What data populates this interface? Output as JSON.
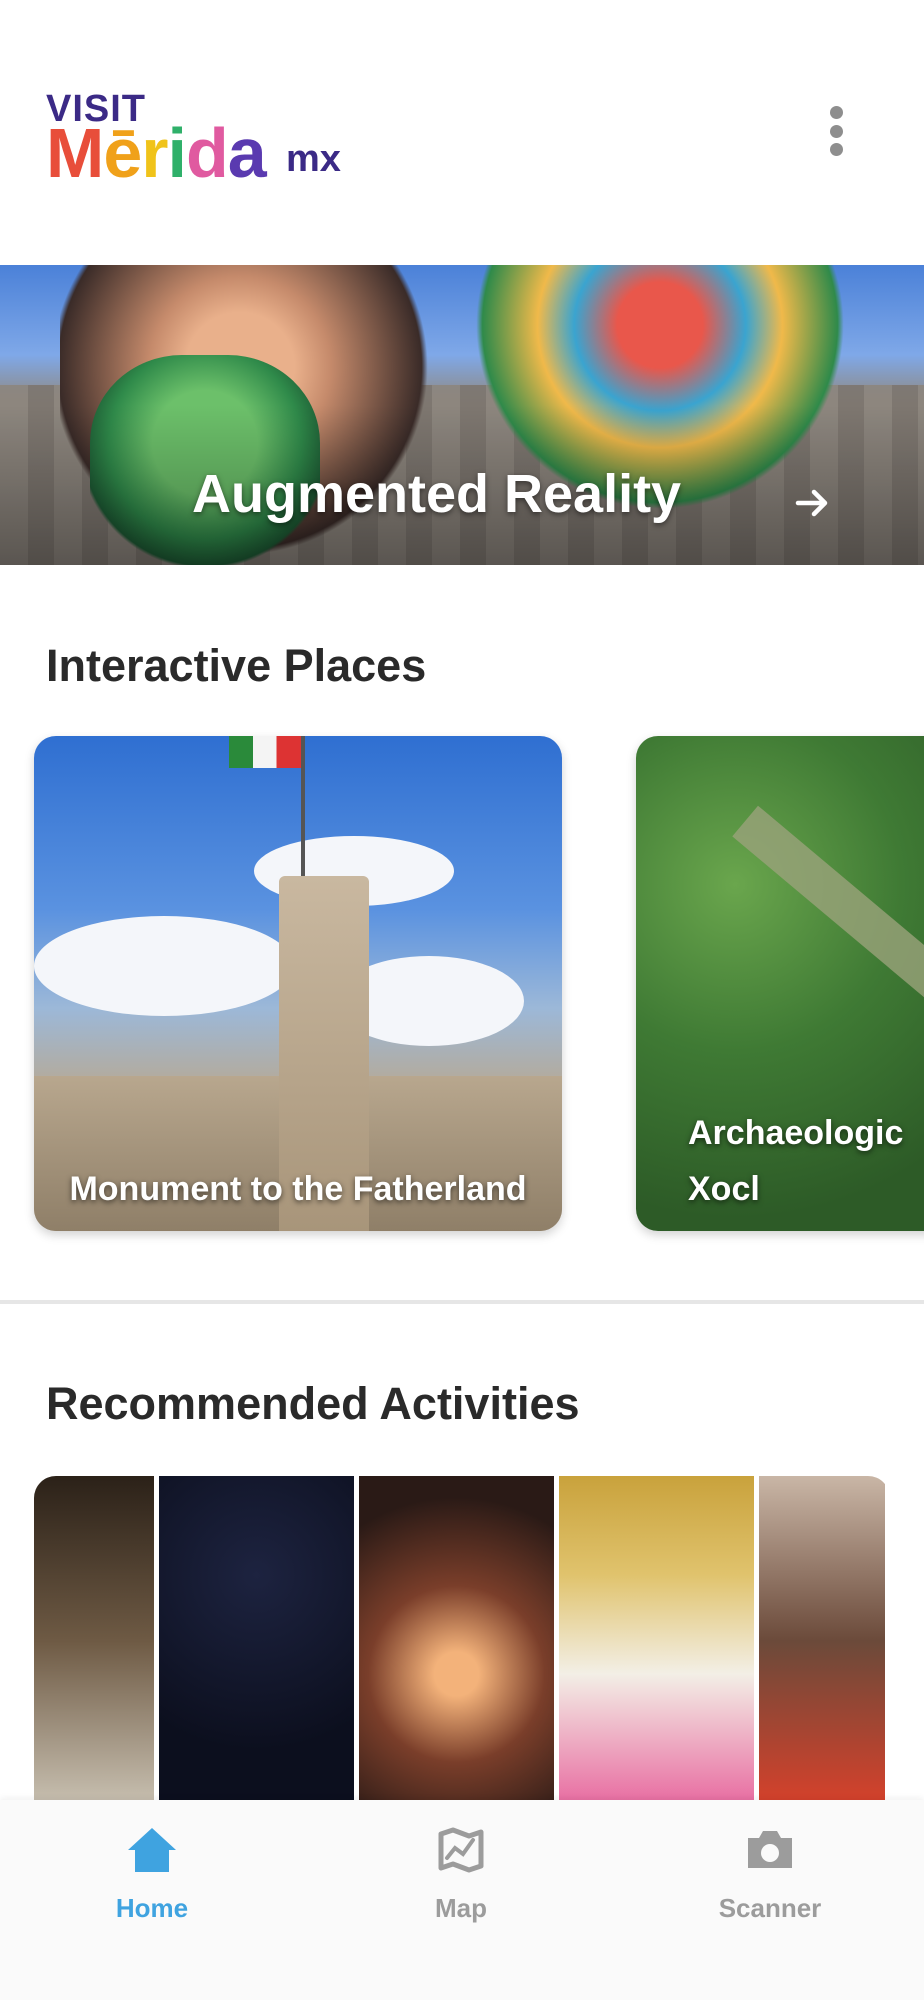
{
  "header": {
    "logo": {
      "visit": "VISIT",
      "letters": [
        "M",
        "ē",
        "r",
        "i",
        "d",
        "a"
      ],
      "suffix": "mx"
    }
  },
  "banner": {
    "title": "Augmented Reality"
  },
  "interactive_places": {
    "title": "Interactive Places",
    "cards": [
      {
        "label": "Monument to the Fatherland"
      },
      {
        "label": "Archaeologic Xocl"
      }
    ]
  },
  "recommended": {
    "title": "Recommended Activities"
  },
  "nav": {
    "items": [
      {
        "label": "Home",
        "icon": "home-icon",
        "active": true,
        "color": "#3fa3e0"
      },
      {
        "label": "Map",
        "icon": "map-icon",
        "active": false,
        "color": "#9c9c9c"
      },
      {
        "label": "Scanner",
        "icon": "camera-icon",
        "active": false,
        "color": "#9c9c9c"
      }
    ]
  },
  "colors": {
    "accent": "#3fa3e0",
    "logo_primary": "#3b2a86"
  }
}
